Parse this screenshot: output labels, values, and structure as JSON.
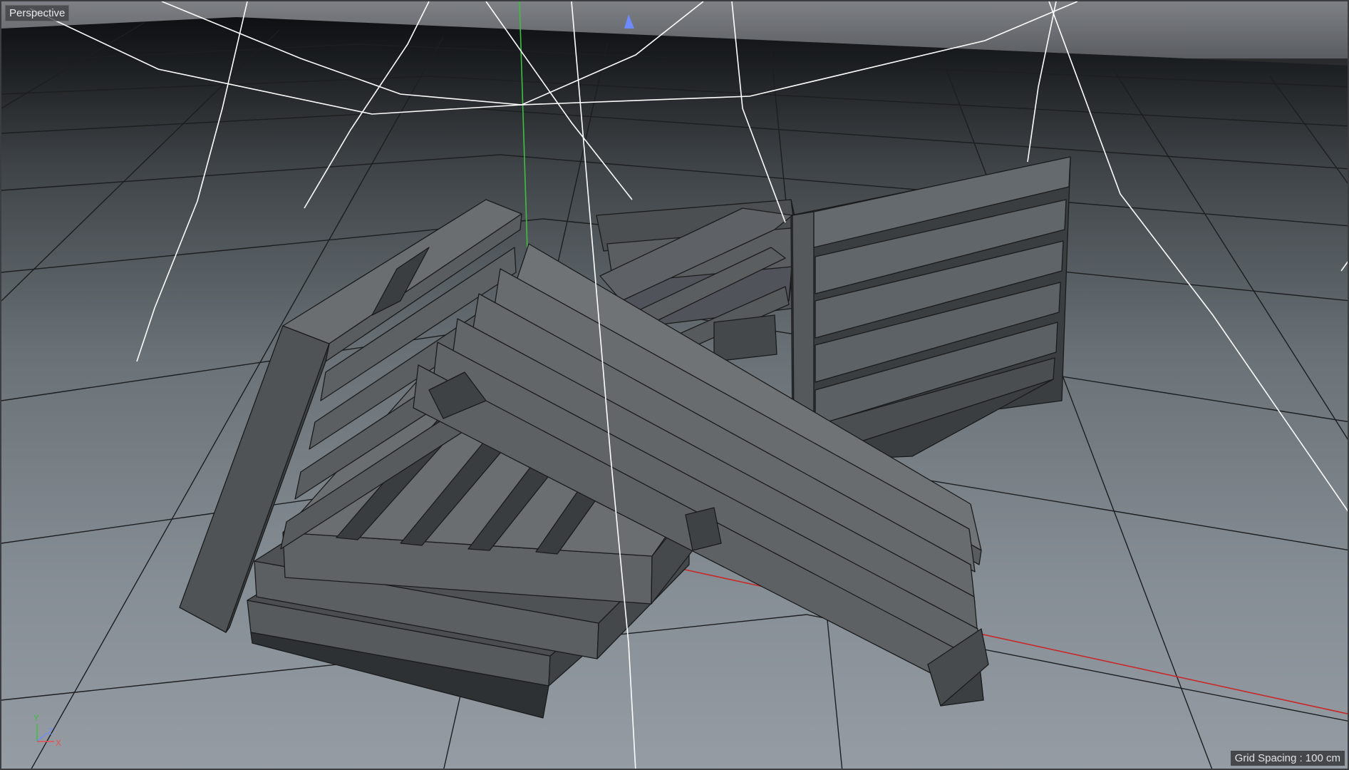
{
  "viewport": {
    "label": "Perspective",
    "grid_info": "Grid Spacing : 100 cm"
  },
  "axis_gizmo": {
    "y": "Y",
    "z": "Z",
    "x": "X"
  },
  "colors": {
    "sky_top": "#0d0f12",
    "floor_far": "#3c4145",
    "floor_near": "#8e969d",
    "grid_line": "#1c1e20",
    "spline": "#ffffff",
    "axis_y": "#3fbf3f",
    "axis_x": "#c82828",
    "pallet_light": "#6a6e71",
    "pallet_mid": "#55595c",
    "pallet_dark": "#3e4245"
  }
}
